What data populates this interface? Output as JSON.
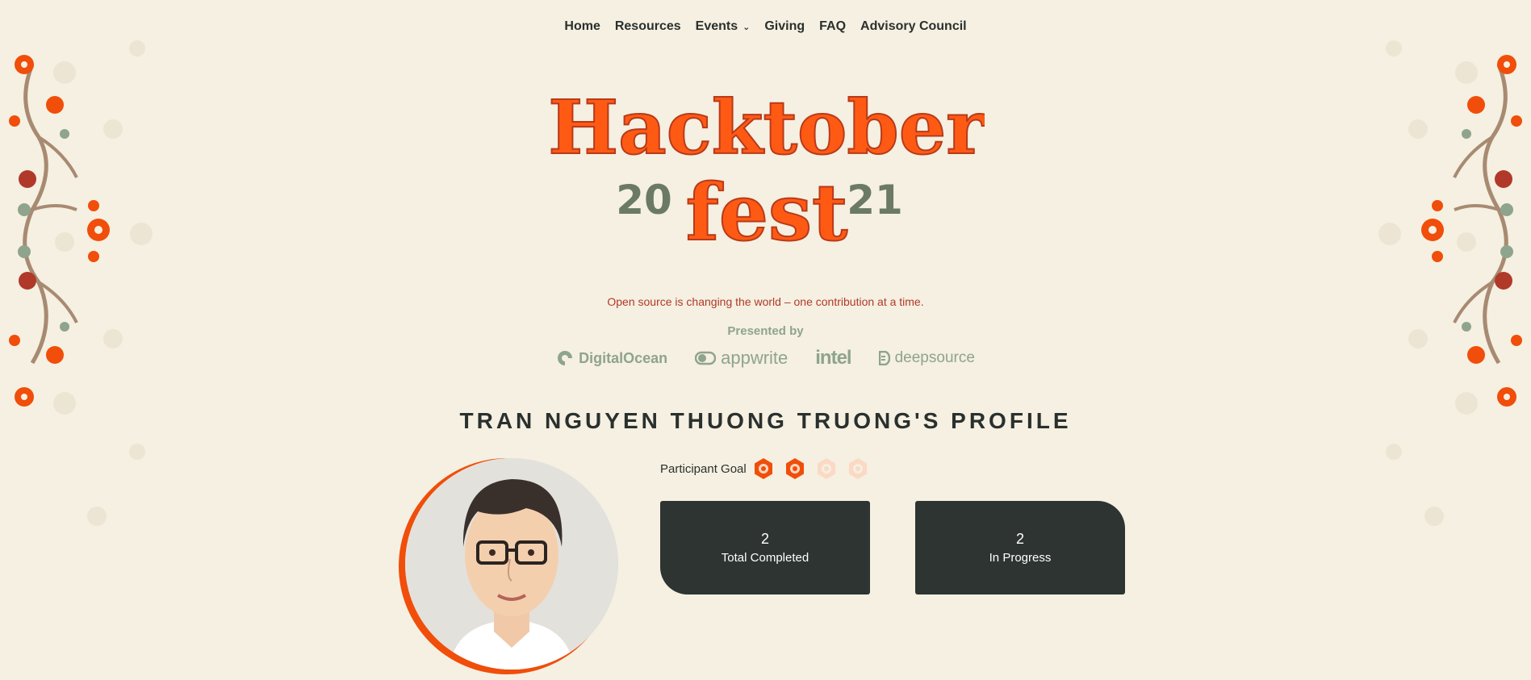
{
  "nav": {
    "items": [
      {
        "label": "Home"
      },
      {
        "label": "Resources"
      },
      {
        "label": "Events"
      },
      {
        "label": "Giving"
      },
      {
        "label": "FAQ"
      },
      {
        "label": "Advisory Council"
      }
    ]
  },
  "logo": {
    "word1": "Hacktober",
    "word2": "fest",
    "year_left": "20",
    "year_right": "21"
  },
  "tagline": "Open source is changing the world – one contribution at a time.",
  "presented_by": "Presented by",
  "sponsors": [
    "DigitalOcean",
    "appwrite",
    "intel",
    "deepsource"
  ],
  "profile": {
    "title": "TRAN NGUYEN THUONG TRUONG'S PROFILE",
    "goal_label": "Participant Goal",
    "goal_progress": {
      "completed": 2,
      "total": 4
    },
    "stats": [
      {
        "value": "2",
        "label": "Total Completed"
      },
      {
        "value": "2",
        "label": "In Progress"
      }
    ]
  },
  "colors": {
    "background": "#f5f0e1",
    "accent": "#f04e0a",
    "dark": "#2d3431",
    "green": "#8fa48c",
    "tagline": "#b0392a"
  },
  "icons": [
    "chevron-down-icon",
    "digitalocean-logo",
    "appwrite-logo",
    "intel-logo",
    "deepsource-logo",
    "goal-badge-icon"
  ]
}
